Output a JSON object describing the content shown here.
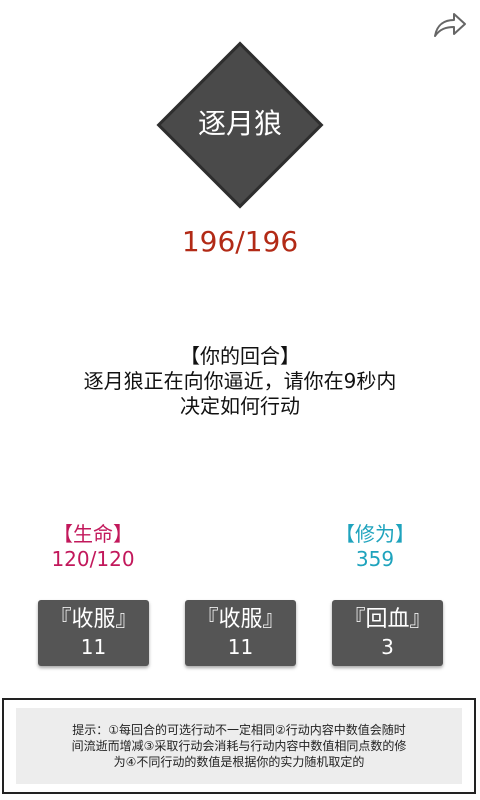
{
  "enemy": {
    "name": "逐月狼",
    "hp": "196/196",
    "diamond_color": "#4a4a4a"
  },
  "message": {
    "title": "【你的回合】",
    "line1": "逐月狼正在向你逼近，请你在9秒内",
    "line2": "决定如何行动"
  },
  "player": {
    "life_label": "【生命】",
    "life_value": "120/120",
    "life_color": "#c2185b",
    "cultivation_label": "【修为】",
    "cultivation_value": "359",
    "cultivation_color": "#1ea3bd"
  },
  "actions": [
    {
      "label": "『收服』",
      "count": "11"
    },
    {
      "label": "『收服』",
      "count": "11"
    },
    {
      "label": "『回血』",
      "count": "3"
    }
  ],
  "tip": {
    "line1": "提示：①每回合的可选行动不一定相同②行动内容中数值会随时",
    "line2": "间流逝而增减③采取行动会消耗与行动内容中数值相同点数的修",
    "line3": "为④不同行动的数值是根据你的实力随机取定的"
  },
  "icons": {
    "share": "share-arrow-icon"
  }
}
